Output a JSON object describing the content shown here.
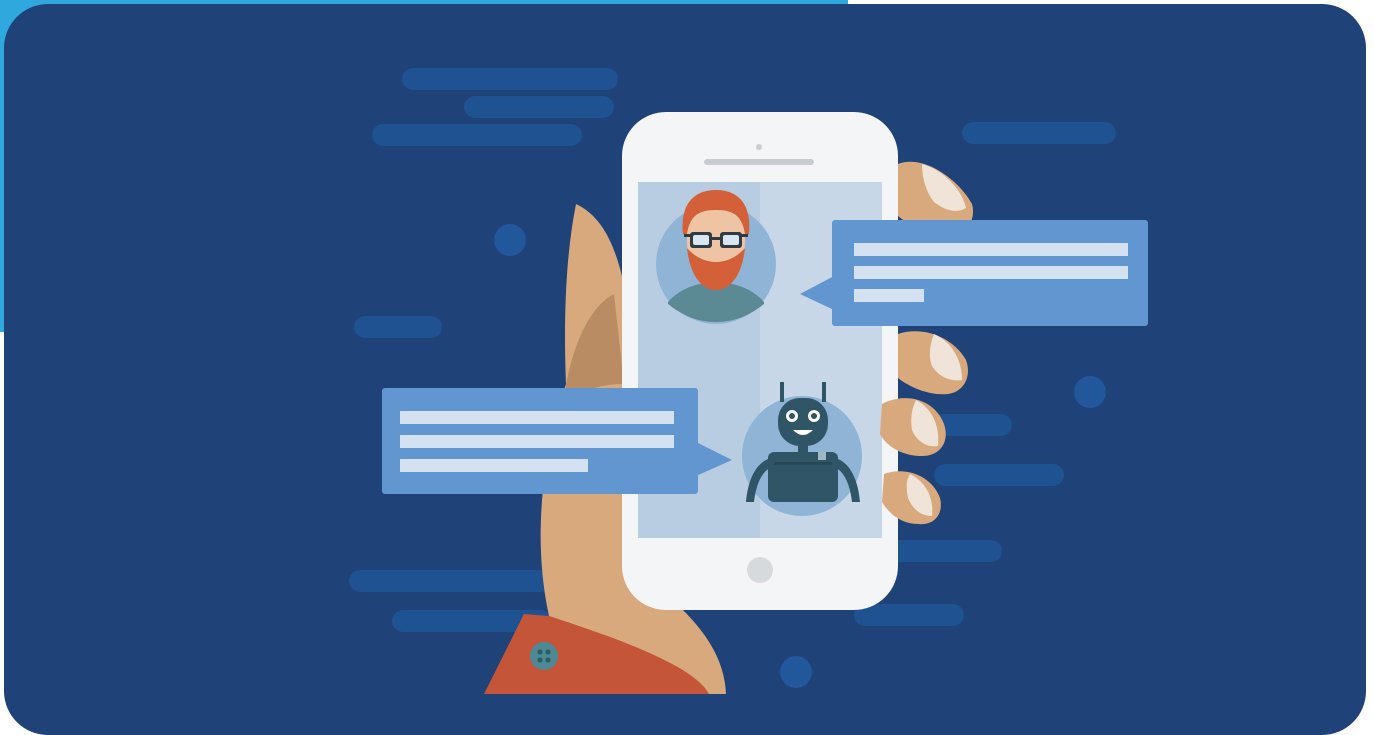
{
  "colors": {
    "accent": "#2fa9dd",
    "background": "#1f4279",
    "cloud": "#1e5291",
    "dot": "#22579b",
    "phone_body": "#f4f5f6",
    "phone_screen": "#b9cde2",
    "phone_screen_shade": "#c7d7e8",
    "bubble": "#6296d0",
    "bubble_line": "#d3e1f0",
    "skin": "#d7a97d",
    "skin_shadow": "#b98c63",
    "nail": "#efe4d7",
    "sleeve": "#c45538",
    "button": "#4d8994",
    "avatar_circle": "#8fb4d6",
    "hair": "#d4603a",
    "glasses": "#2f3a43",
    "shirt": "#5b8a95",
    "robot": "#2f5566"
  },
  "icons": {
    "user_avatar": "bearded-man-with-glasses-avatar-icon",
    "bot_avatar": "robot-avatar-icon",
    "hand": "hand-holding-phone-icon"
  }
}
